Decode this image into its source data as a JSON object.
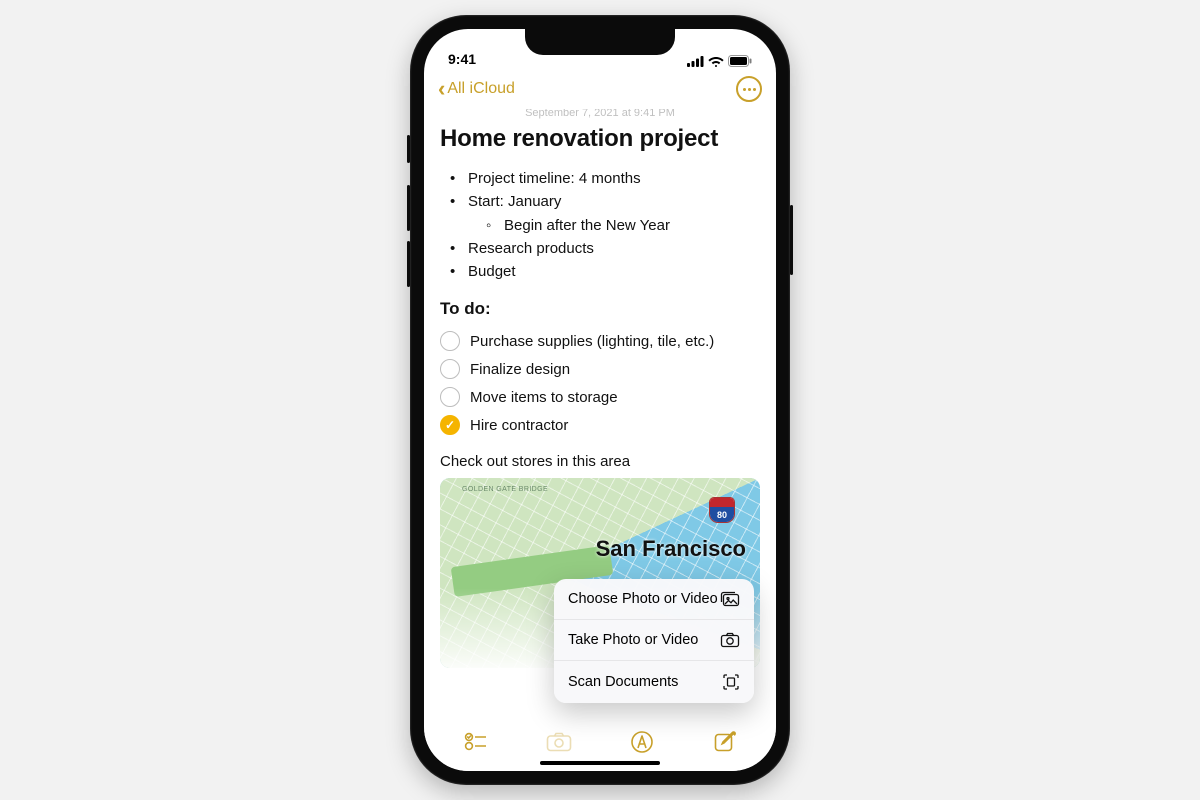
{
  "status": {
    "time": "9:41"
  },
  "nav": {
    "back_label": "All iCloud"
  },
  "note": {
    "timestamp": "September 7, 2021 at 9:41 PM",
    "title": "Home renovation project",
    "bullets": {
      "b0": "Project timeline: 4 months",
      "b1": "Start: January",
      "b1_sub0": "Begin after the New Year",
      "b2": "Research products",
      "b3": "Budget"
    },
    "todo_heading": "To do:",
    "todos": {
      "t0": "Purchase supplies (lighting, tile, etc.)",
      "t1": "Finalize design",
      "t2": "Move items to storage",
      "t3": "Hire contractor"
    },
    "area_text": "Check out stores in this area",
    "map": {
      "bridge_label": "GOLDEN GATE\nBRIDGE",
      "highway": "80",
      "city": "San Francisco"
    }
  },
  "menu": {
    "choose": "Choose Photo or Video",
    "take": "Take Photo or Video",
    "scan": "Scan Documents"
  }
}
